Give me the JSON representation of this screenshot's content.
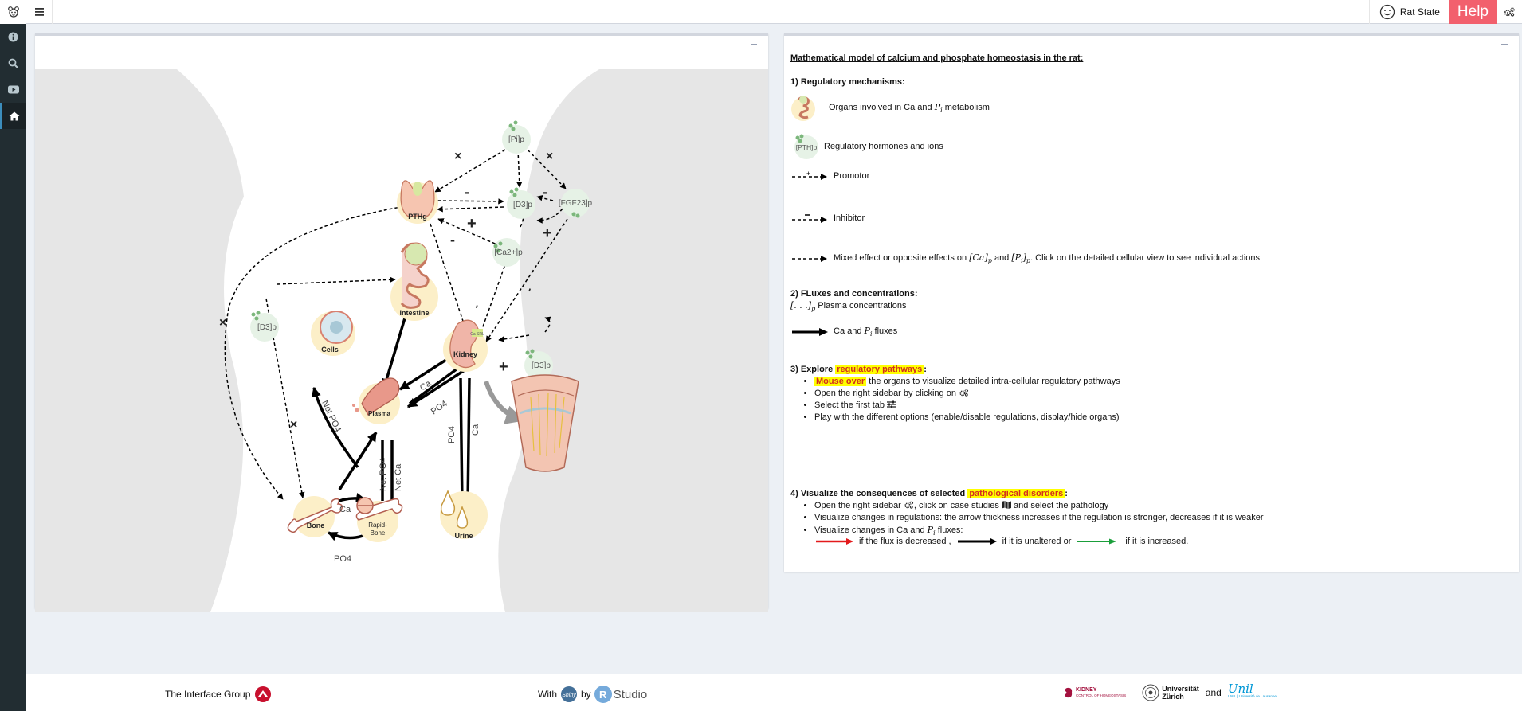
{
  "header": {
    "user_label": "Rat State",
    "help_label": "Help"
  },
  "sidebar": {
    "items": [
      {
        "icon": "info-icon"
      },
      {
        "icon": "search-icon"
      },
      {
        "icon": "youtube-icon"
      },
      {
        "icon": "home-icon"
      }
    ]
  },
  "diagram": {
    "nodes": {
      "pi": "[Pi]p",
      "pthg": "PTHg",
      "d3_top": "[D3]p",
      "fgf23": "[FGF23]p",
      "ca": "[Ca2+]p",
      "d3_left": "[D3]p",
      "d3_right": "[D3]p",
      "intestine": "Intestine",
      "cells": "Cells",
      "kidney": "Kidney",
      "plasma": "Plasma",
      "bone": "Bone",
      "rapid_bone_1": "Rapid-",
      "rapid_bone_2": "Bone",
      "urine": "Urine"
    },
    "signs": {
      "cross": "×",
      "plus": "+",
      "minus": "-"
    },
    "flux_labels": {
      "net_po4_cells": "Net PO4",
      "ca_kidney": "Ca",
      "po4_kidney": "PO4",
      "po4_urine": "PO4",
      "ca_urine": "Ca",
      "net_po4_plasma": "Net PO4",
      "net_ca_plasma": "Net Ca",
      "ca_bone": "Ca",
      "po4_bone": "PO4"
    }
  },
  "info": {
    "title": "Mathematical model of calcium and phosphate homeostasis in the rat:",
    "section1": "1) Regulatory mechanisms:",
    "organs_pre": "Organs involved in Ca and ",
    "organs_math": "P",
    "organs_sub": "i",
    "organs_post": " metabolism",
    "hormones_icon_label": "[PTH]p",
    "hormones": "Regulatory hormones and ions",
    "promotor": "Promotor",
    "inhibitor": "Inhibitor",
    "mixed_pre": "Mixed effect or opposite effects on ",
    "mixed_math1": "[Ca]",
    "mixed_sub1": "p",
    "mixed_mid": " and ",
    "mixed_math2": "[P",
    "mixed_sub2a": "i",
    "mixed_math2b": "]",
    "mixed_sub2": "p",
    "mixed_post": ". Click on the detailed cellular view to see individual actions",
    "section2": "2) FLuxes and concentrations:",
    "plasma_math": "[. . .]",
    "plasma_sub": "p",
    "plasma_text": " Plasma concentrations",
    "fluxes_pre": "Ca and ",
    "fluxes_math": "P",
    "fluxes_sub": "i",
    "fluxes_post": " fluxes",
    "section3_pre": "3) Explore ",
    "section3_hl": "regulatory pathways",
    "section3_post": ":",
    "explore_items": {
      "mouse_over": "Mouse over",
      "mouse_over_text": " the organs to visualize detailed intra-cellular regulatory pathways",
      "open_sidebar": "Open the right sidebar by clicking on ",
      "select_tab": "Select the first tab ",
      "play": "Play with the different options (enable/disable regulations, display/hide organs)"
    },
    "section4_pre": "4) Visualize the consequences of selected ",
    "section4_hl": "pathological disorders",
    "section4_post": ":",
    "vis_items": {
      "open_pre": "Open the right sidebar ",
      "open_mid": ", click on case studies ",
      "open_post": " and select the pathology",
      "thickness": "Visualize changes in regulations: the arrow thickness increases if the regulation is stronger, decreases if it is weaker",
      "changes_pre": "Visualize changes in Ca and ",
      "changes_math": "P",
      "changes_sub": "i",
      "changes_post": " fluxes:"
    },
    "legend_decreased": " if the flux is decreased ,",
    "legend_unaltered": " if it is unaltered or",
    "legend_increased": "if it is increased.",
    "colors": {
      "decreased": "#e31a1c",
      "unaltered": "#000000",
      "increased": "#1a9e3a",
      "highlight_bg": "#ffff00",
      "highlight_text": "#d32e1e",
      "help_bg": "#f2606d"
    }
  },
  "footer": {
    "interface_group": "The Interface Group",
    "with": "With",
    "shiny": "Shiny",
    "by": "by",
    "rstudio_r": "R",
    "rstudio": "Studio",
    "kidney_line1": "KIDNEY",
    "kidney_line2": "CONTROL OF HOMEOSTASIS",
    "uzh_line1": "Universität",
    "uzh_line2": "Zürich",
    "and": "and",
    "unil": "Unil",
    "unil_sub": "UNIL | Université de Lausanne"
  }
}
